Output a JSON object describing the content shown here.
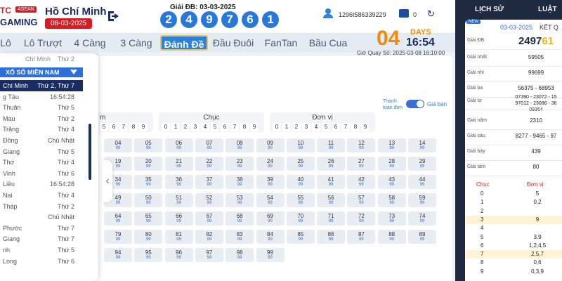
{
  "header": {
    "logo_top": "TC",
    "logo_asean": "ASEAN",
    "logo_bottom": "GAMING",
    "province": "Hồ Chí Minh",
    "date": "08-03-2025",
    "special_label": "Giải ĐB: 03-03-2025",
    "special_digits": [
      "2",
      "4",
      "9",
      "7",
      "6",
      "1"
    ],
    "user_id": "1296t586339229",
    "balance": "0"
  },
  "nav": {
    "tabs": [
      "Lô",
      "Lô Trượt",
      "4 Càng",
      "3 Càng",
      "Đánh Đề",
      "Đầu Đuôi",
      "FanTan",
      "Bầu Cua"
    ],
    "active_index": 4
  },
  "countdown": {
    "days": "04",
    "days_label": "DAYS",
    "time": "16:54",
    "next_draw": "Giờ Quay Số: 2025-03-08 16:10:00"
  },
  "grid": {
    "toggle_left": "Thanh toán đơn",
    "toggle_right": "Giá bán",
    "group_left_title": "m",
    "group_chuc_title": "Chục",
    "group_donvi_title": "Đơn vị",
    "left_digits": [
      "5",
      "6",
      "7",
      "8",
      "9"
    ],
    "digits": [
      "0",
      "1",
      "2",
      "3",
      "4",
      "5",
      "6",
      "7",
      "8",
      "9"
    ],
    "rows": [
      [
        {
          "n": "04",
          "v": "99"
        },
        {
          "n": "05",
          "v": "99"
        },
        {
          "n": "06",
          "v": "99"
        },
        {
          "n": "07",
          "v": "99"
        },
        {
          "n": "08",
          "v": "99"
        },
        {
          "n": "09",
          "v": "99"
        },
        {
          "n": "10",
          "v": "99"
        },
        {
          "n": "11",
          "v": "99"
        },
        {
          "n": "12",
          "v": "99"
        },
        {
          "n": "13",
          "v": "99"
        },
        {
          "n": "14",
          "v": "99"
        }
      ],
      [
        {
          "n": "19",
          "v": "99"
        },
        {
          "n": "20",
          "v": "99"
        },
        {
          "n": "21",
          "v": "99"
        },
        {
          "n": "22",
          "v": "99"
        },
        {
          "n": "23",
          "v": "99"
        },
        {
          "n": "24",
          "v": "99"
        },
        {
          "n": "25",
          "v": "99"
        },
        {
          "n": "26",
          "v": "99"
        },
        {
          "n": "27",
          "v": "99"
        },
        {
          "n": "28",
          "v": "99"
        },
        {
          "n": "29",
          "v": "99"
        }
      ],
      [
        {
          "n": "34",
          "v": "99"
        },
        {
          "n": "35",
          "v": "99"
        },
        {
          "n": "36",
          "v": "99"
        },
        {
          "n": "37",
          "v": "99"
        },
        {
          "n": "38",
          "v": "99"
        },
        {
          "n": "39",
          "v": "99"
        },
        {
          "n": "40",
          "v": "99"
        },
        {
          "n": "41",
          "v": "99"
        },
        {
          "n": "42",
          "v": "99"
        },
        {
          "n": "43",
          "v": "99"
        },
        {
          "n": "44",
          "v": "99"
        }
      ],
      [
        {
          "n": "49",
          "v": "99"
        },
        {
          "n": "50",
          "v": "99"
        },
        {
          "n": "51",
          "v": "99"
        },
        {
          "n": "52",
          "v": "99"
        },
        {
          "n": "53",
          "v": "99"
        },
        {
          "n": "54",
          "v": "99"
        },
        {
          "n": "55",
          "v": "99"
        },
        {
          "n": "56",
          "v": "99"
        },
        {
          "n": "57",
          "v": "99"
        },
        {
          "n": "58",
          "v": "99"
        },
        {
          "n": "59",
          "v": "99"
        }
      ],
      [
        {
          "n": "64",
          "v": "99"
        },
        {
          "n": "65",
          "v": "99"
        },
        {
          "n": "66",
          "v": "99"
        },
        {
          "n": "67",
          "v": "99"
        },
        {
          "n": "68",
          "v": "99"
        },
        {
          "n": "69",
          "v": "99"
        },
        {
          "n": "70",
          "v": "99"
        },
        {
          "n": "71",
          "v": "99"
        },
        {
          "n": "72",
          "v": "99"
        },
        {
          "n": "73",
          "v": "99"
        },
        {
          "n": "74",
          "v": "99"
        }
      ],
      [
        {
          "n": "79",
          "v": "99"
        },
        {
          "n": "80",
          "v": "99"
        },
        {
          "n": "81",
          "v": "99"
        },
        {
          "n": "82",
          "v": "99"
        },
        {
          "n": "83",
          "v": "99"
        },
        {
          "n": "84",
          "v": "99"
        },
        {
          "n": "85",
          "v": "99"
        },
        {
          "n": "86",
          "v": "99"
        },
        {
          "n": "87",
          "v": "99"
        },
        {
          "n": "88",
          "v": "99"
        },
        {
          "n": "89",
          "v": "99"
        }
      ],
      [
        {
          "n": "94",
          "v": "99"
        },
        {
          "n": "95",
          "v": "99"
        },
        {
          "n": "96",
          "v": "99"
        },
        {
          "n": "97",
          "v": "99"
        },
        {
          "n": "98",
          "v": "99"
        },
        {
          "n": "99",
          "v": "99"
        }
      ]
    ]
  },
  "menu": {
    "top_row": {
      "name": "Chí Minh",
      "day": "Thứ 2"
    },
    "header": "XỔ SỐ MIỀN NAM",
    "items": [
      {
        "name": "Chí Minh",
        "day": "Thứ 2, Thứ 7",
        "selected": true
      },
      {
        "name": "g Tàu",
        "day": "16:54:28"
      },
      {
        "name": "Thuận",
        "day": "Thứ 5"
      },
      {
        "name": "Mau",
        "day": "Thứ 2"
      },
      {
        "name": "Trăng",
        "day": "Thứ 4"
      },
      {
        "name": "Đồng",
        "day": "Chủ Nhật"
      },
      {
        "name": "Giang",
        "day": "Thứ 5"
      },
      {
        "name": "Thơ",
        "day": "Thứ 4"
      },
      {
        "name": "Vinh",
        "day": "Thứ 6"
      },
      {
        "name": "Liêu",
        "day": "16:54:28"
      },
      {
        "name": "Nai",
        "day": "Thứ 4"
      },
      {
        "name": "Tháp",
        "day": "Thứ 2"
      },
      {
        "name": "",
        "day": "Chủ Nhật"
      },
      {
        "name": "Phước",
        "day": "Thứ 7"
      },
      {
        "name": "Giang",
        "day": "Thứ 7"
      },
      {
        "name": "nh",
        "day": "Thứ 5"
      },
      {
        "name": "Long",
        "day": "Thứ 6"
      }
    ]
  },
  "results": {
    "tab_history": "LỊCH SỬ",
    "tab_result": "LUẬT",
    "new_badge": "NEW",
    "date": "03-03-2025",
    "title": "KẾT Q",
    "prizes": [
      {
        "label": "Giải ĐB",
        "value": "2497",
        "highlight": "61"
      },
      {
        "label": "Giải nhất",
        "value": "59505"
      },
      {
        "label": "Giải nhì",
        "value": "99699"
      },
      {
        "label": "Giải ba",
        "value": "56375 - 68953"
      },
      {
        "label": "Giải tư",
        "value": "07390 - 23072 - 15 97012 - 23086 - 36 09364"
      },
      {
        "label": "Giải năm",
        "value": "2310"
      },
      {
        "label": "Giải sáu",
        "value": "8277 - 9465 - 97"
      },
      {
        "label": "Giải bảy",
        "value": "439"
      },
      {
        "label": "Giải tám",
        "value": "80"
      }
    ],
    "loto_header_chuc": "Chục",
    "loto_header_donvi": "Đơn vị",
    "loto": [
      {
        "chuc": "0",
        "donvi": "5"
      },
      {
        "chuc": "1",
        "donvi": "0,2"
      },
      {
        "chuc": "2",
        "donvi": ""
      },
      {
        "chuc": "3",
        "donvi": "9"
      },
      {
        "chuc": "4",
        "donvi": ""
      },
      {
        "chuc": "5",
        "donvi": "3,9"
      },
      {
        "chuc": "6",
        "donvi": "1,2,4,5"
      },
      {
        "chuc": "7",
        "donvi": "2,5,7"
      },
      {
        "chuc": "8",
        "donvi": "0,6"
      },
      {
        "chuc": "9",
        "donvi": "0,3,9"
      }
    ]
  },
  "colors": {
    "brand_blue": "#2c81dc",
    "brand_red": "#d21f26",
    "countdown_orange": "#f28a0a",
    "dark_navy": "#1f2a40"
  }
}
